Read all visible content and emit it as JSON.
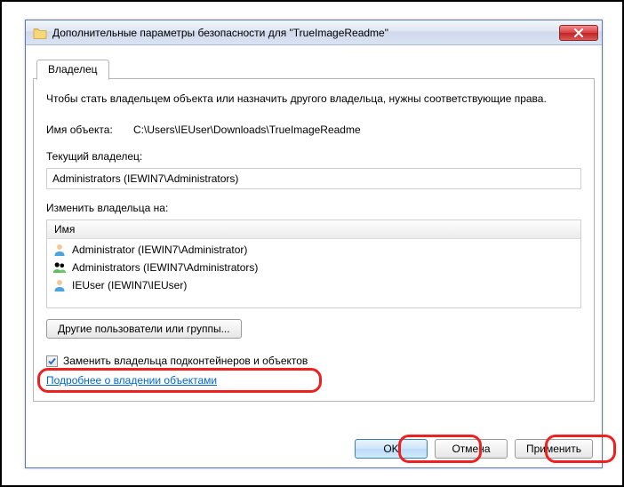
{
  "window": {
    "title": "Дополнительные параметры безопасности  для \"TrueImageReadme\""
  },
  "tab": {
    "label": "Владелец"
  },
  "page": {
    "description": "Чтобы стать владельцем объекта или назначить другого владельца, нужны соответствующие права.",
    "object_label": "Имя объекта:",
    "object_path": "C:\\Users\\IEUser\\Downloads\\TrueImageReadme",
    "current_owner_label": "Текущий владелец:",
    "current_owner_value": "Administrators (IEWIN7\\Administrators)",
    "change_owner_label": "Изменить владельца на:",
    "owner_list_header": "Имя",
    "owners": [
      {
        "type": "user",
        "label": "Administrator (IEWIN7\\Administrator)"
      },
      {
        "type": "group",
        "label": "Administrators (IEWIN7\\Administrators)"
      },
      {
        "type": "user",
        "label": "IEUser (IEWIN7\\IEUser)"
      }
    ],
    "other_users_btn": "Другие пользователи или группы...",
    "replace_owner_checkbox": {
      "checked": true,
      "label": "Заменить владельца подконтейнеров и объектов"
    },
    "learn_more_link": "Подробнее о владении объектами"
  },
  "footer": {
    "ok": "OK",
    "cancel": "Отмена",
    "apply": "Применить"
  }
}
